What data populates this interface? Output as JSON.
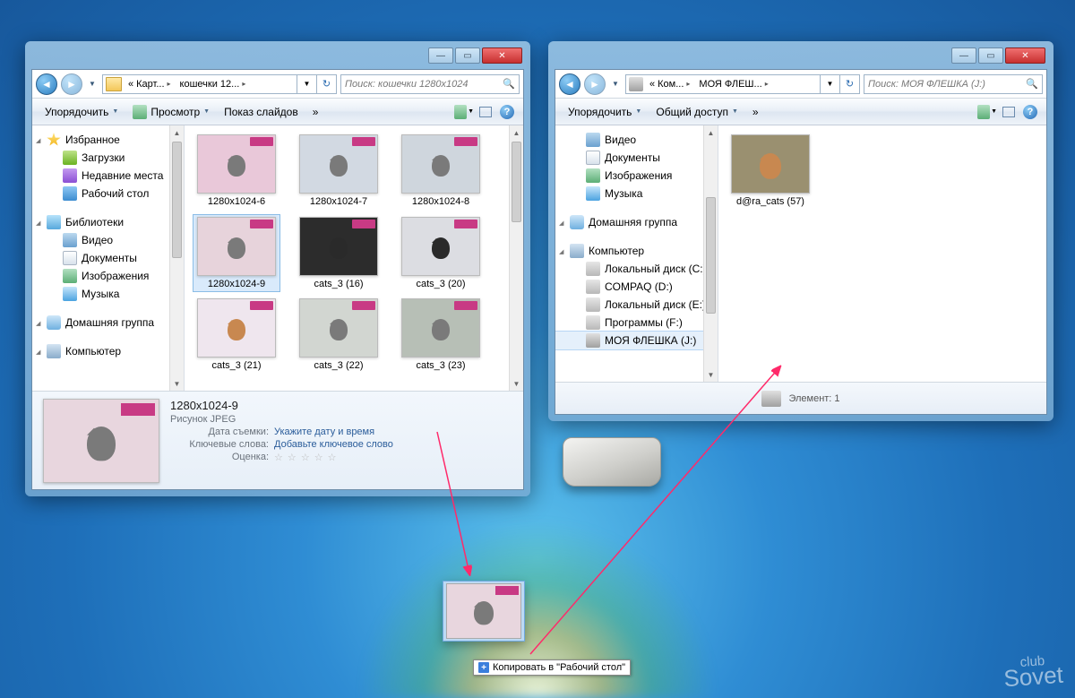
{
  "win1": {
    "crumb1": "Карт...",
    "crumb2": "кошечки 12...",
    "search_ph": "Поиск: кошечки 1280x1024",
    "toolbar": {
      "organize": "Упорядочить",
      "view": "Просмотр",
      "slideshow": "Показ слайдов",
      "overflow": "»"
    },
    "nav": {
      "fav": "Избранное",
      "downloads": "Загрузки",
      "recent": "Недавние места",
      "desktop": "Рабочий стол",
      "libs": "Библиотеки",
      "video": "Видео",
      "docs": "Документы",
      "images": "Изображения",
      "music": "Музыка",
      "homegroup": "Домашняя группа",
      "computer": "Компьютер"
    },
    "thumbs": [
      {
        "label": "1280x1024-6",
        "bg": "#e9c8d9",
        "cat": ""
      },
      {
        "label": "1280x1024-7",
        "bg": "#d2d9e2",
        "cat": ""
      },
      {
        "label": "1280x1024-8",
        "bg": "#cfd6dd",
        "cat": ""
      },
      {
        "label": "1280x1024-9",
        "bg": "#e7d3db",
        "cat": "",
        "sel": true
      },
      {
        "label": "cats_3 (16)",
        "bg": "#2c2c2c",
        "cat": "b"
      },
      {
        "label": "cats_3 (20)",
        "bg": "#dcdde2",
        "cat": "b"
      },
      {
        "label": "cats_3 (21)",
        "bg": "#efe6ee",
        "cat": "o"
      },
      {
        "label": "cats_3 (22)",
        "bg": "#d2d6d1",
        "cat": ""
      },
      {
        "label": "cats_3 (23)",
        "bg": "#b7bfb6",
        "cat": ""
      }
    ],
    "details": {
      "title": "1280x1024-9",
      "type": "Рисунок JPEG",
      "date_l": "Дата съемки:",
      "date_v": "Укажите дату и время",
      "keys_l": "Ключевые слова:",
      "keys_v": "Добавьте ключевое слово",
      "rate_l": "Оценка:"
    }
  },
  "win2": {
    "crumb1": "Ком...",
    "crumb2": "МОЯ ФЛЕШ...",
    "search_ph": "Поиск: МОЯ ФЛЕШКА (J:)",
    "toolbar": {
      "organize": "Упорядочить",
      "share": "Общий доступ",
      "overflow": "»"
    },
    "nav": {
      "video": "Видео",
      "docs": "Документы",
      "images": "Изображения",
      "music": "Музыка",
      "homegroup": "Домашняя группа",
      "computer": "Компьютер",
      "disk_c": "Локальный диск (C:)",
      "disk_d": "COMPAQ (D:)",
      "disk_e": "Локальный диск (E:)",
      "disk_f": "Программы  (F:)",
      "disk_j": "МОЯ ФЛЕШКА (J:)"
    },
    "thumb": "d@ra_cats (57)",
    "status": "Элемент: 1"
  },
  "drag_tooltip": "Копировать в \"Рабочий стол\"",
  "watermark": {
    "top": "club",
    "bot": "Sovet"
  }
}
